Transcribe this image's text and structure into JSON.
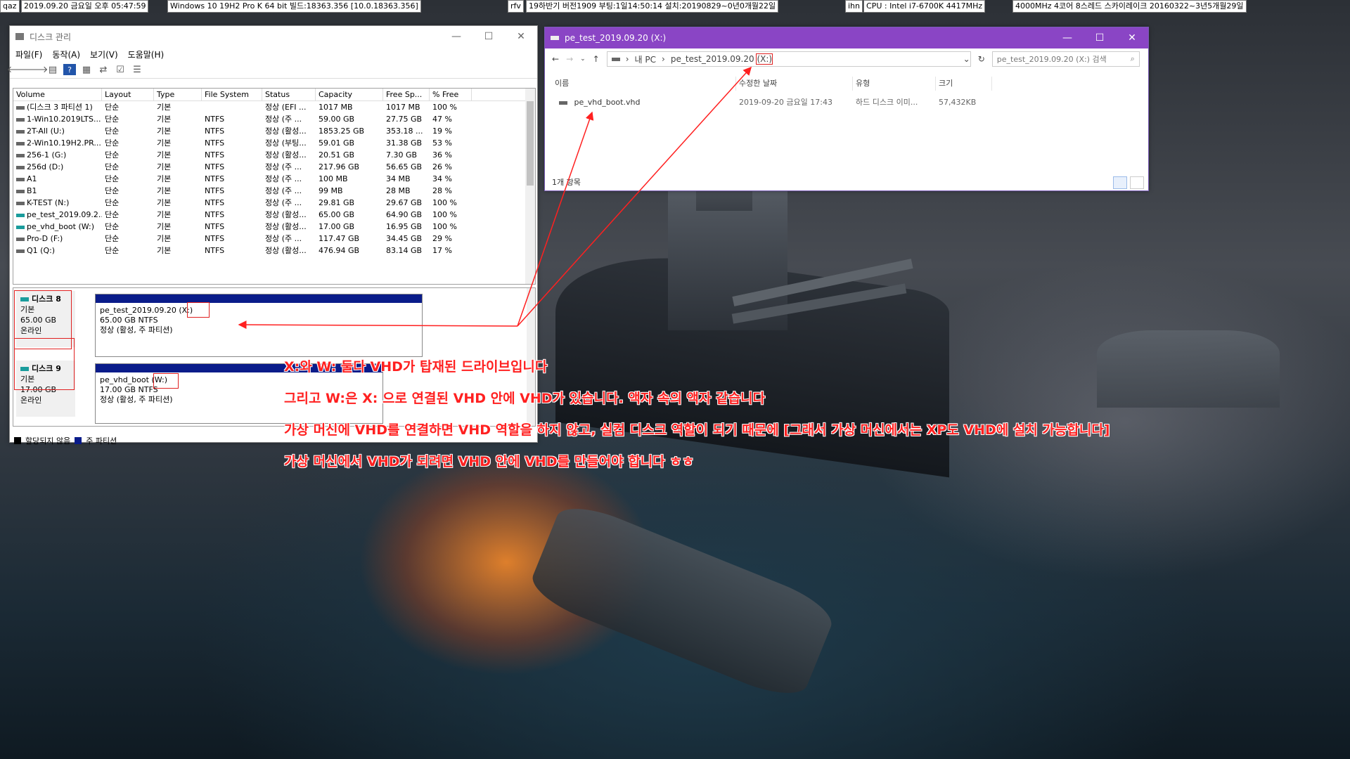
{
  "infobar": {
    "cells": [
      {
        "id": "user",
        "text": "qaz"
      },
      {
        "id": "datetime",
        "text": "2019.09.20 금요일 오후 05:47:59"
      },
      {
        "id": "os",
        "text": "Windows 10 19H2 Pro K 64 bit 빌드:18363.356 [10.0.18363.356]"
      },
      {
        "id": "rfv",
        "text": "rfv"
      },
      {
        "id": "version",
        "text": "19하반기 버전1909 부팅:1일14:50:14 설치:20190829~0년0개월22일"
      },
      {
        "id": "ihn",
        "text": "ihn"
      },
      {
        "id": "cpu",
        "text": "CPU : Intel i7-6700K 4417MHz"
      },
      {
        "id": "cpu2",
        "text": "4000MHz 4코어 8스레드 스카이레이크 20160322~3년5개월29일"
      }
    ]
  },
  "disk_mgmt": {
    "title": "디스크 관리",
    "menu": [
      "파일(F)",
      "동작(A)",
      "보기(V)",
      "도움말(H)"
    ],
    "columns": [
      "Volume",
      "Layout",
      "Type",
      "File System",
      "Status",
      "Capacity",
      "Free Sp...",
      "% Free"
    ],
    "rows": [
      {
        "volume": "(디스크 3 파티션 1)",
        "layout": "단순",
        "type": "기본",
        "fs": "",
        "status": "정상 (EFI ...",
        "capacity": "1017 MB",
        "free": "1017 MB",
        "pct": "100 %",
        "vhd": false
      },
      {
        "volume": "1-Win10.2019LTS...",
        "layout": "단순",
        "type": "기본",
        "fs": "NTFS",
        "status": "정상 (주 ...",
        "capacity": "59.00 GB",
        "free": "27.75 GB",
        "pct": "47 %",
        "vhd": false
      },
      {
        "volume": "2T-All (U:)",
        "layout": "단순",
        "type": "기본",
        "fs": "NTFS",
        "status": "정상 (활성...",
        "capacity": "1853.25 GB",
        "free": "353.18 ...",
        "pct": "19 %",
        "vhd": false
      },
      {
        "volume": "2-Win10.19H2.PR...",
        "layout": "단순",
        "type": "기본",
        "fs": "NTFS",
        "status": "정상 (부팅...",
        "capacity": "59.01 GB",
        "free": "31.38 GB",
        "pct": "53 %",
        "vhd": false
      },
      {
        "volume": "256-1 (G:)",
        "layout": "단순",
        "type": "기본",
        "fs": "NTFS",
        "status": "정상 (활성...",
        "capacity": "20.51 GB",
        "free": "7.30 GB",
        "pct": "36 %",
        "vhd": false
      },
      {
        "volume": "256d (D:)",
        "layout": "단순",
        "type": "기본",
        "fs": "NTFS",
        "status": "정상 (주 ...",
        "capacity": "217.96 GB",
        "free": "56.65 GB",
        "pct": "26 %",
        "vhd": false
      },
      {
        "volume": "A1",
        "layout": "단순",
        "type": "기본",
        "fs": "NTFS",
        "status": "정상 (주 ...",
        "capacity": "100 MB",
        "free": "34 MB",
        "pct": "34 %",
        "vhd": false
      },
      {
        "volume": "B1",
        "layout": "단순",
        "type": "기본",
        "fs": "NTFS",
        "status": "정상 (주 ...",
        "capacity": "99 MB",
        "free": "28 MB",
        "pct": "28 %",
        "vhd": false
      },
      {
        "volume": "K-TEST (N:)",
        "layout": "단순",
        "type": "기본",
        "fs": "NTFS",
        "status": "정상 (주 ...",
        "capacity": "29.81 GB",
        "free": "29.67 GB",
        "pct": "100 %",
        "vhd": false
      },
      {
        "volume": "pe_test_2019.09.2...",
        "layout": "단순",
        "type": "기본",
        "fs": "NTFS",
        "status": "정상 (활성...",
        "capacity": "65.00 GB",
        "free": "64.90 GB",
        "pct": "100 %",
        "vhd": true
      },
      {
        "volume": "pe_vhd_boot (W:)",
        "layout": "단순",
        "type": "기본",
        "fs": "NTFS",
        "status": "정상 (활성...",
        "capacity": "17.00 GB",
        "free": "16.95 GB",
        "pct": "100 %",
        "vhd": true
      },
      {
        "volume": "Pro-D (F:)",
        "layout": "단순",
        "type": "기본",
        "fs": "NTFS",
        "status": "정상 (주 ...",
        "capacity": "117.47 GB",
        "free": "34.45 GB",
        "pct": "29 %",
        "vhd": false
      },
      {
        "volume": "Q1 (Q:)",
        "layout": "단순",
        "type": "기본",
        "fs": "NTFS",
        "status": "정상 (활성...",
        "capacity": "476.94 GB",
        "free": "83.14 GB",
        "pct": "17 %",
        "vhd": false
      }
    ],
    "disk8": {
      "name": "디스크 8",
      "kind": "기본",
      "size": "65.00 GB",
      "state": "온라인",
      "part_name": "pe_test_2019.09.20",
      "part_letter": "(X:)",
      "part_size": "65.00 GB NTFS",
      "part_status": "정상 (활성, 주 파티션)"
    },
    "disk9": {
      "name": "디스크 9",
      "kind": "기본",
      "size": "17.00 GB",
      "state": "온라인",
      "part_name": "pe_vhd_boot",
      "part_letter": "(W:)",
      "part_size": "17.00 GB NTFS",
      "part_status": "정상 (활성, 주 파티션)"
    },
    "legend": {
      "unallocated": "할당되지 않음",
      "primary": "주 파티션"
    }
  },
  "explorer": {
    "title": "pe_test_2019.09.20 (X:)",
    "crumbs": [
      "내 PC",
      "pe_test_2019.09.20",
      "(X:)"
    ],
    "search_placeholder": "pe_test_2019.09.20 (X:) 검색",
    "columns": [
      "이름",
      "수정한 날짜",
      "유형",
      "크기"
    ],
    "file": {
      "name": "pe_vhd_boot.vhd",
      "date": "2019-09-20 금요일 17:43",
      "type": "하드 디스크 이미...",
      "size": "57,432KB"
    },
    "status": "1개 항목"
  },
  "annotations": [
    "X:와 W: 둘다 VHD가 탑재된 드라이브입니다",
    "그리고 W:은  X: 으로 연결된 VHD 안에 VHD가 있습니다. 액자 속의 액자 같습니다",
    "가상 머신에 VHD를 연결하면 VHD 역할을 하지 않고, 실컴 디스크 역할이 되기 때문에 [그래서 가상 머신에서는 XP도 VHD에 설치 가능합니다]",
    "가상 머신에서 VHD가 되려면 VHD 안에 VHD를 만들어야 합니다 ㅎㅎ"
  ],
  "colors": {
    "explorer_titlebar": "#8a45c5",
    "annotation": "#ff2020",
    "partition_bar": "#0a1c8a",
    "vhd_icon": "#1a9c9c"
  }
}
